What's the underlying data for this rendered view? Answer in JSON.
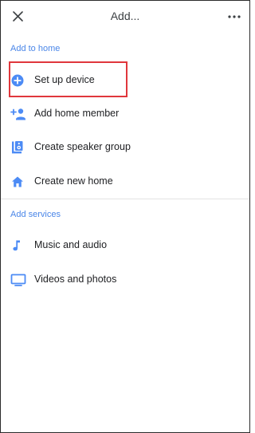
{
  "header": {
    "title": "Add..."
  },
  "sections": [
    {
      "label": "Add to home",
      "items": [
        {
          "label": "Set up device",
          "icon": "add-circle-icon"
        },
        {
          "label": "Add home member",
          "icon": "add-person-icon"
        },
        {
          "label": "Create speaker group",
          "icon": "speaker-group-icon"
        },
        {
          "label": "Create new home",
          "icon": "home-icon"
        }
      ]
    },
    {
      "label": "Add services",
      "items": [
        {
          "label": "Music and audio",
          "icon": "music-note-icon"
        },
        {
          "label": "Videos and photos",
          "icon": "tv-icon"
        }
      ]
    }
  ],
  "colors": {
    "accent": "#4a86e8",
    "icon_blue": "#4c8bf5",
    "highlight": "#e0373c"
  }
}
